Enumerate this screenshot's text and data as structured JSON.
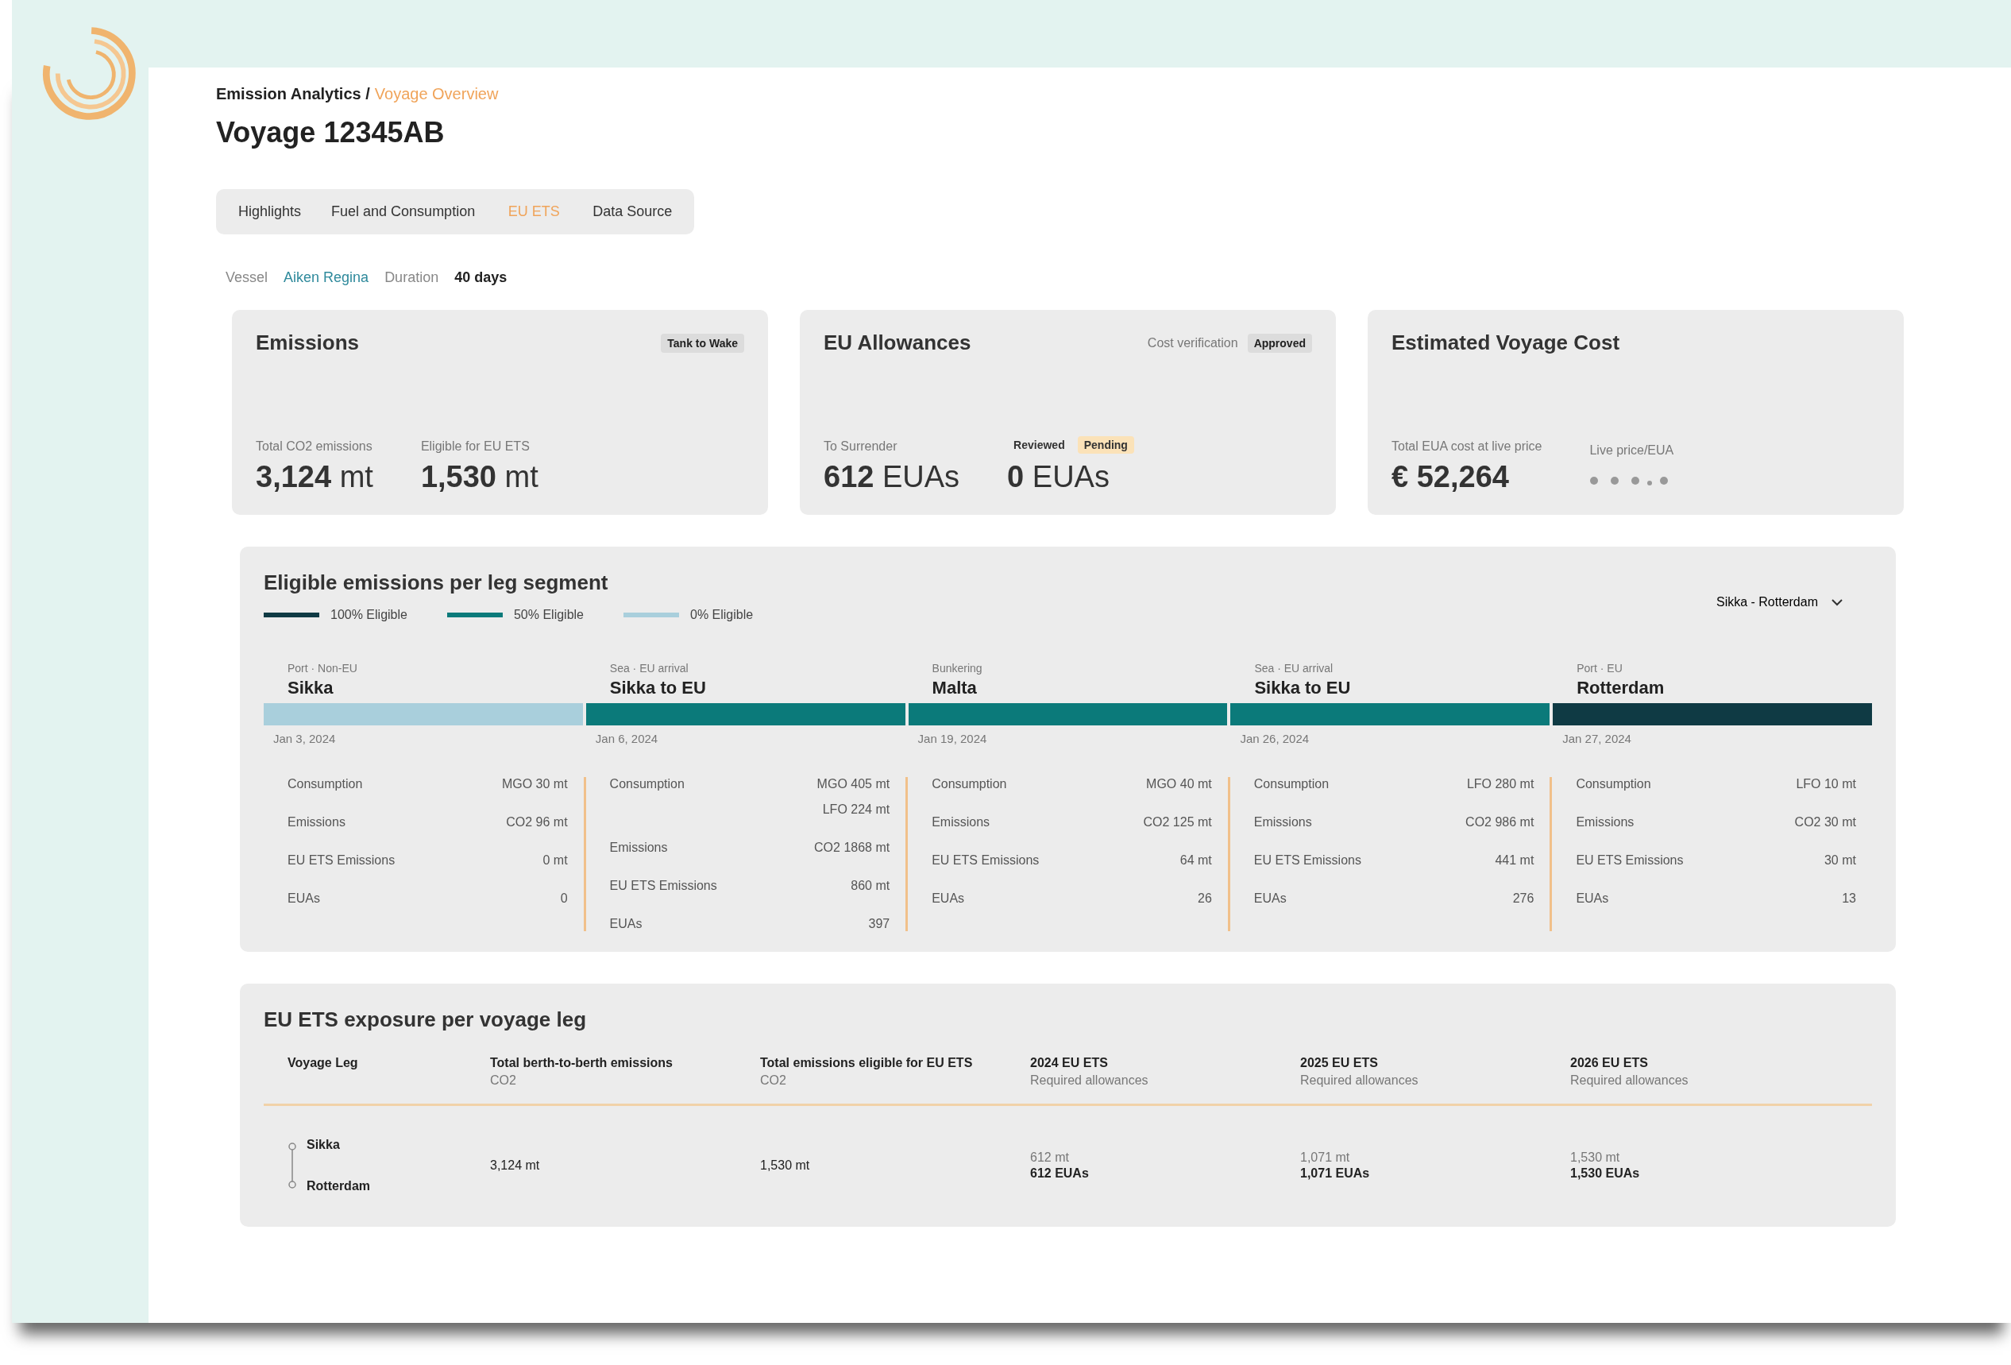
{
  "breadcrumb": {
    "parent": "Emission Analytics /",
    "current": "Voyage Overview"
  },
  "title": "Voyage 12345AB",
  "tabs": [
    {
      "label": "Highlights",
      "selected": false
    },
    {
      "label": "Fuel and Consumption",
      "selected": false
    },
    {
      "label": "EU ETS",
      "selected": true
    },
    {
      "label": "Data Source",
      "selected": false
    }
  ],
  "meta": {
    "vessel_label": "Vessel",
    "vessel": "Aiken Regina",
    "duration_label": "Duration",
    "duration": "40 days"
  },
  "emissions_card": {
    "title": "Emissions",
    "badge": "Tank to Wake",
    "stats": [
      {
        "label": "Total CO2 emissions",
        "value": "3,124",
        "unit": "mt"
      },
      {
        "label": "Eligible for EU ETS",
        "value": "1,530",
        "unit": "mt"
      }
    ]
  },
  "allowances_card": {
    "title": "EU Allowances",
    "verification_label": "Cost verification",
    "verification_status": "Approved",
    "surrender_label": "To Surrender",
    "surrender_value": "612",
    "surrender_unit": "EUAs",
    "filters": [
      {
        "label": "Reviewed",
        "selected": false
      },
      {
        "label": "Pending",
        "selected": true
      }
    ],
    "filtered_value": "0",
    "filtered_unit": "EUAs"
  },
  "cost_card": {
    "title": "Estimated Voyage Cost",
    "total_label": "Total EUA cost at live price",
    "total_value": "€ 52,264",
    "price_label": "Live price/EUA"
  },
  "segments_panel": {
    "title": "Eligible emissions per leg segment",
    "legend": [
      {
        "label": "100% Eligible",
        "color": "#0f3a44"
      },
      {
        "label": "50% Eligible",
        "color": "#0b7a7a"
      },
      {
        "label": "0% Eligible",
        "color": "#a9cfdc"
      }
    ],
    "route_select": "Sikka - Rotterdam",
    "segments": [
      {
        "type": "Port · Non-EU",
        "name": "Sikka",
        "color": "#a9cfdc",
        "date": "Jan 3, 2024",
        "stats": [
          {
            "label": "Consumption",
            "values": [
              "MGO 30 mt"
            ]
          },
          {
            "label": "Emissions",
            "values": [
              "CO2 96 mt"
            ]
          },
          {
            "label": "EU ETS Emissions",
            "values": [
              "0 mt"
            ]
          },
          {
            "label": "EUAs",
            "values": [
              "0"
            ]
          }
        ]
      },
      {
        "type": "Sea · EU arrival",
        "name": "Sikka to EU",
        "color": "#0b7a7a",
        "date": "Jan 6, 2024",
        "stats": [
          {
            "label": "Consumption",
            "values": [
              "MGO 405 mt",
              "LFO 224 mt"
            ]
          },
          {
            "label": "Emissions",
            "values": [
              "CO2 1868 mt"
            ]
          },
          {
            "label": "EU ETS Emissions",
            "values": [
              "860 mt"
            ]
          },
          {
            "label": "EUAs",
            "values": [
              "397"
            ]
          }
        ]
      },
      {
        "type": "Bunkering",
        "name": "Malta",
        "color": "#0b7a7a",
        "date": "Jan 19, 2024",
        "stats": [
          {
            "label": "Consumption",
            "values": [
              "MGO 40 mt"
            ]
          },
          {
            "label": "Emissions",
            "values": [
              "CO2 125 mt"
            ]
          },
          {
            "label": "EU ETS Emissions",
            "values": [
              "64 mt"
            ]
          },
          {
            "label": "EUAs",
            "values": [
              "26"
            ]
          }
        ]
      },
      {
        "type": "Sea · EU arrival",
        "name": "Sikka to EU",
        "color": "#0b7a7a",
        "date": "Jan 26, 2024",
        "stats": [
          {
            "label": "Consumption",
            "values": [
              "LFO 280 mt"
            ]
          },
          {
            "label": "Emissions",
            "values": [
              "CO2 986 mt"
            ]
          },
          {
            "label": "EU ETS Emissions",
            "values": [
              "441 mt"
            ]
          },
          {
            "label": "EUAs",
            "values": [
              "276"
            ]
          }
        ]
      },
      {
        "type": "Port · EU",
        "name": "Rotterdam",
        "color": "#0f3a44",
        "date": "Jan 27, 2024",
        "stats": [
          {
            "label": "Consumption",
            "values": [
              "LFO 10 mt"
            ]
          },
          {
            "label": "Emissions",
            "values": [
              "CO2 30 mt"
            ]
          },
          {
            "label": "EU ETS Emissions",
            "values": [
              "30 mt"
            ]
          },
          {
            "label": "EUAs",
            "values": [
              "13"
            ]
          }
        ]
      }
    ]
  },
  "exposure_table": {
    "title": "EU ETS exposure per voyage leg",
    "columns": [
      {
        "label": "Voyage Leg"
      },
      {
        "label": "Total berth-to-berth emissions",
        "sub": "CO2"
      },
      {
        "label": "Total emissions eligible for EU ETS",
        "sub": "CO2"
      },
      {
        "label": "2024 EU ETS",
        "sub": "Required allowances"
      },
      {
        "label": "2025 EU ETS",
        "sub": "Required allowances"
      },
      {
        "label": "2026 EU ETS",
        "sub": "Required allowances"
      }
    ],
    "rows": [
      {
        "from": "Sikka",
        "to": "Rotterdam",
        "total": "3,124 mt",
        "eligible": "1,530 mt",
        "years": [
          {
            "mt": "612 mt",
            "euas": "612 EUAs"
          },
          {
            "mt": "1,071 mt",
            "euas": "1,071 EUAs"
          },
          {
            "mt": "1,530 mt",
            "euas": "1,530 EUAs"
          }
        ]
      }
    ]
  }
}
